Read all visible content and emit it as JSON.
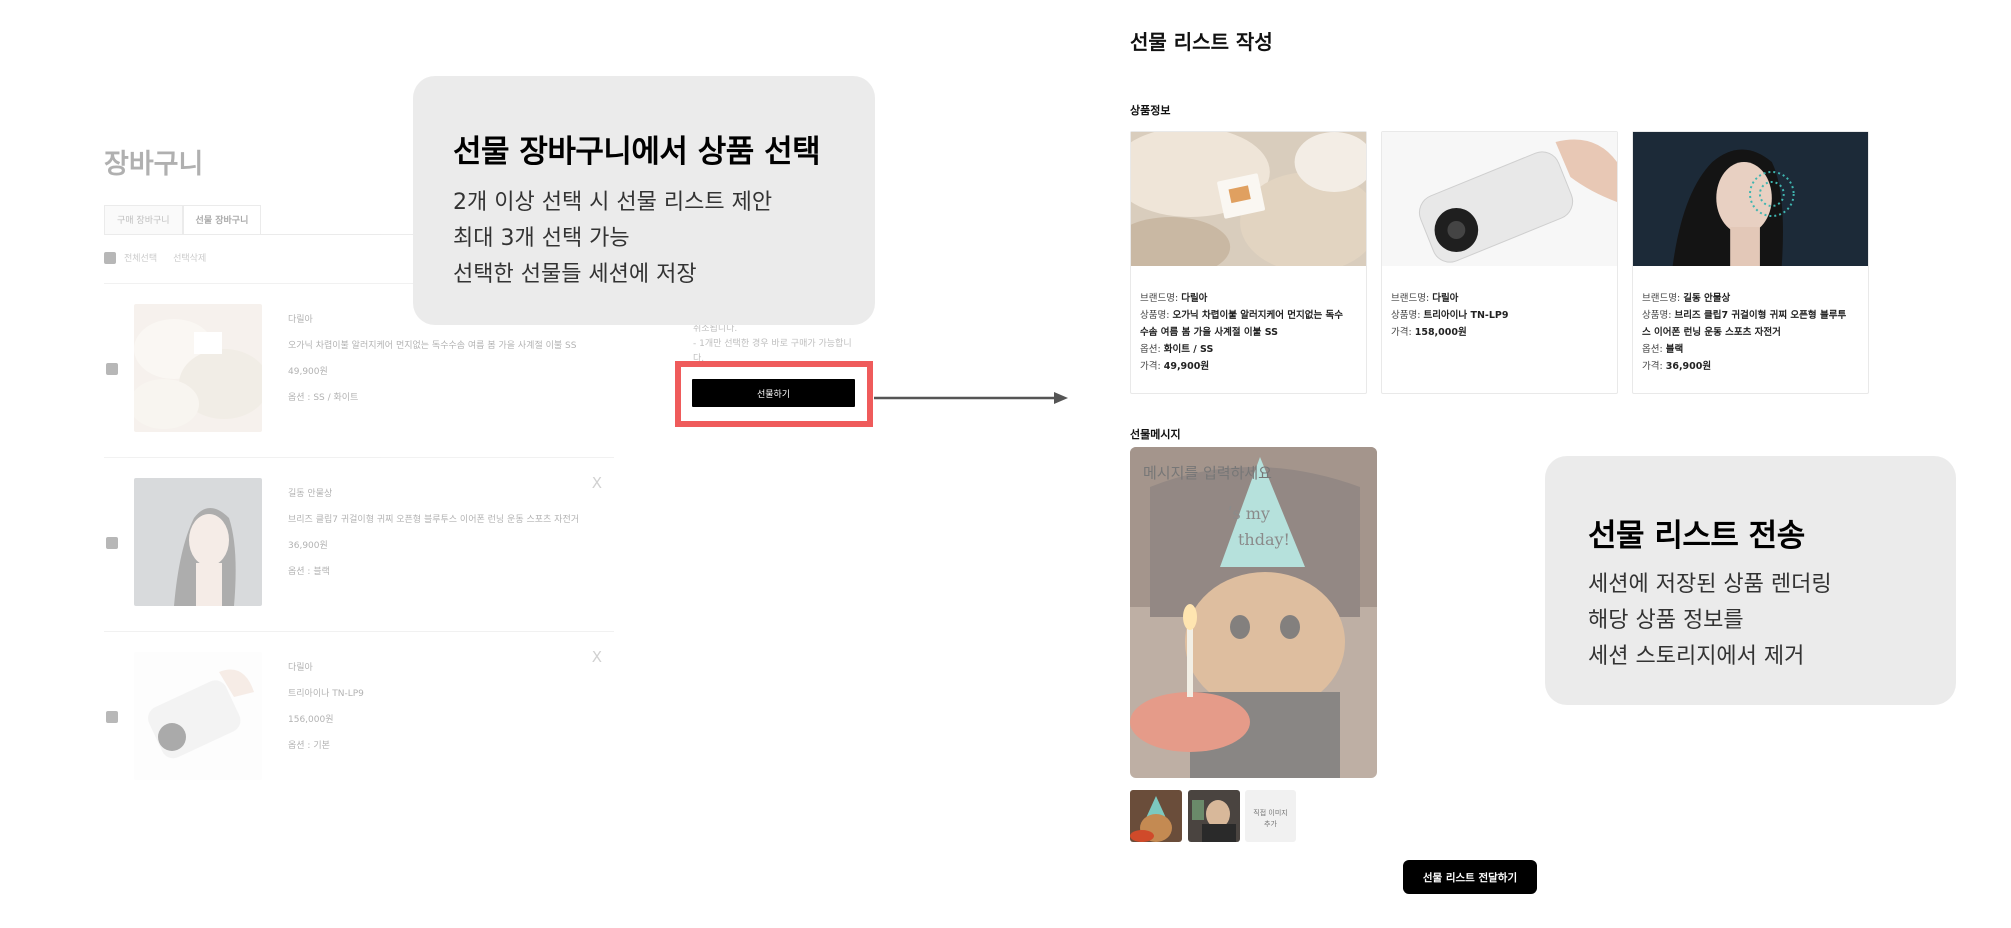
{
  "cart": {
    "title": "장바구니",
    "tabs": [
      "구매 장바구니",
      "선물 장바구니"
    ],
    "select_all": "전체선택",
    "delete_selected": "선택삭제",
    "items": [
      {
        "brand": "다릴아",
        "name": "오가닉 차렵이불 알러지케어 먼지없는 독수수솜 여름 봄 가을 사계절 이불 SS",
        "price": "49,900원",
        "option": "옵션 : SS / 화이트"
      },
      {
        "brand": "길동 안물상",
        "name": "브리즈 클립7 귀걸이형 귀찌 오픈형 블루투스 이어폰 런닝 운동 스포츠 자전거",
        "price": "36,900원",
        "option": "옵션 : 블랙"
      },
      {
        "brand": "다릴아",
        "name": "트리아이나 TN-LP9",
        "price": "156,000원",
        "option": "옵션 : 기본"
      }
    ],
    "remove_icon": "X",
    "notice_lines": [
      "취소됩니다.",
      "- 1개만 선택한 경우 바로 구매가 가능합니",
      "다."
    ],
    "gift_button": "선물하기"
  },
  "callout_select": {
    "title": "선물 장바구니에서 상품 선택",
    "lines": [
      "2개 이상 선택 시 선물 리스트 제안",
      "최대 3개 선택 가능",
      "선택한 선물들 세션에 저장"
    ]
  },
  "callout_send": {
    "title": "선물 리스트 전송",
    "lines": [
      "세션에 저장된 상품 렌더링",
      "해당 상품 정보를",
      "세션 스토리지에서 제거"
    ]
  },
  "gift_list": {
    "title": "선물 리스트 작성",
    "product_section": "상품정보",
    "label_brand": "브랜드명:",
    "label_name": "상품명:",
    "label_option": "옵션:",
    "label_price": "가격:",
    "products": [
      {
        "brand": "다릴아",
        "name_l1": "오가닉 차렵이불 알러지케어 먼지없는 독수",
        "name_l2": "수솜 여름 봄 가을 사계절 이불 SS",
        "option": "화이트 / SS",
        "price": "49,900원"
      },
      {
        "brand": "다릴아",
        "name_l1": "트리아이나 TN-LP9",
        "name_l2": "",
        "option": "",
        "price": "158,000원"
      },
      {
        "brand": "길동 안물상",
        "name_l1": "브리즈 클립7 귀걸이형 귀찌 오픈형 블루투",
        "name_l2": "스 이어폰 런닝 운동 스포츠 자전거",
        "option": "블랙",
        "price": "36,900원"
      }
    ],
    "message_section": "선물메시지",
    "message_placeholder": "메시지를 입력하세요",
    "card_text": "ʹs my thday!",
    "add_image": [
      "직접 이미지",
      "추가"
    ],
    "send_button": "선물 리스트 전달하기"
  },
  "colors": {
    "highlight": "#ef5b5b",
    "callout_bg": "#ebebeb",
    "button": "#000000"
  }
}
